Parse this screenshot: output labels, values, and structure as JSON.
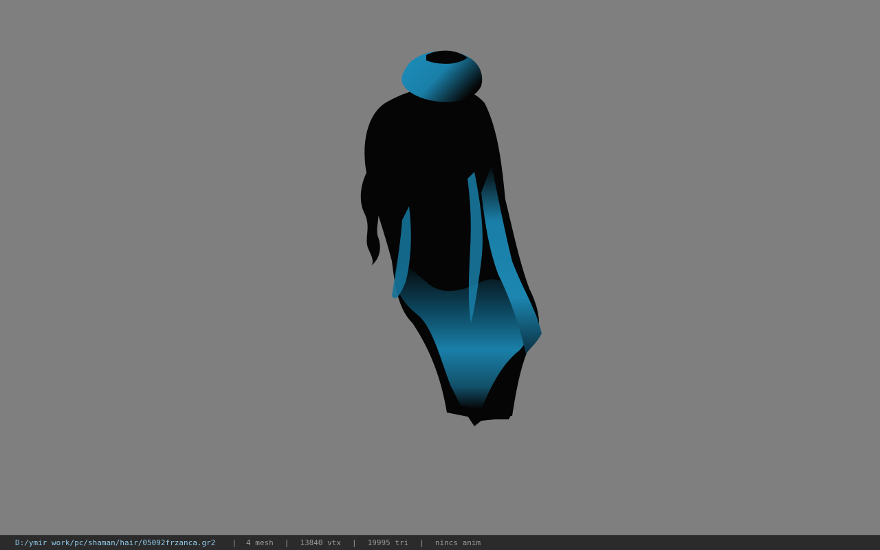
{
  "viewport": {
    "background_color": "#7f7f7f",
    "model_icon": "hair-model-icon",
    "hair_colors": {
      "dark": "#050505",
      "accent": "#1a7fa8"
    }
  },
  "status_bar": {
    "file_path": "D:/ymir work/pc/shaman/hair/05092frzanca.gr2",
    "separator": "|",
    "mesh": "4 mesh",
    "vertices": "13840 vtx",
    "triangles": "19995 tri",
    "anim": "nincs anim"
  }
}
